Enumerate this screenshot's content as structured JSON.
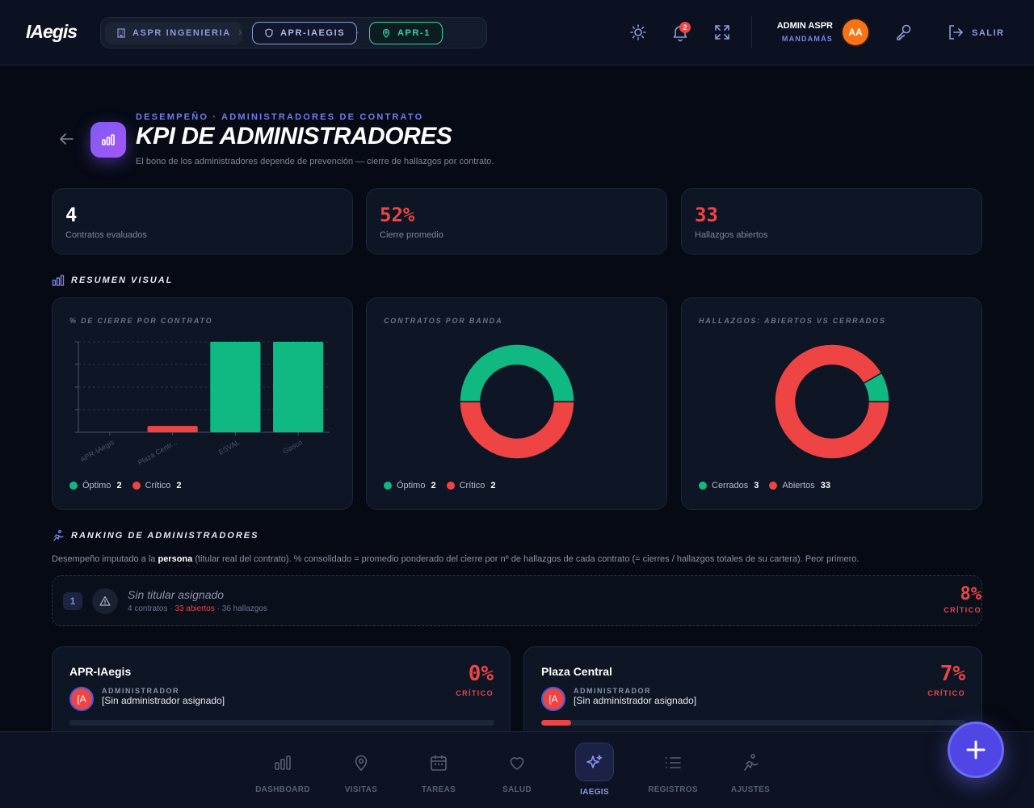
{
  "app": {
    "logo": "IAegis"
  },
  "breadcrumb": [
    {
      "label": "ASPR INGENIERIA"
    },
    {
      "label": "APR-IAEGIS"
    },
    {
      "label": "APR-1"
    }
  ],
  "header": {
    "notifications_count": "2",
    "user_name": "ADMIN ASPR",
    "user_role": "MANDAMÁS",
    "user_initials": "AA",
    "logout_label": "SALIR"
  },
  "page": {
    "eyebrow": "DESEMPEÑO · ADMINISTRADORES DE CONTRATO",
    "title": "KPI DE ADMINISTRADORES",
    "subtitle": "El bono de los administradores depende de prevención — cierre de hallazgos por contrato."
  },
  "kpis": [
    {
      "value": "4",
      "label": "Contratos evaluados",
      "color": "#ffffff"
    },
    {
      "value": "52%",
      "label": "Cierre promedio",
      "color": "#ef4444"
    },
    {
      "value": "33",
      "label": "Hallazgos abiertos",
      "color": "#ef4444"
    }
  ],
  "sections": {
    "visual": "RESUMEN VISUAL",
    "ranking": "RANKING DE ADMINISTRADORES"
  },
  "chart_data": [
    {
      "type": "bar",
      "title": "% DE CIERRE POR CONTRATO",
      "categories": [
        "APR-IAegis",
        "Plaza Centr...",
        "ESVAL",
        "Gasco"
      ],
      "values": [
        0,
        7,
        100,
        100
      ],
      "colors": [
        "#ef4444",
        "#ef4444",
        "#10b981",
        "#10b981"
      ],
      "ylim": [
        0,
        100
      ],
      "grid": true,
      "legend": [
        {
          "name": "Óptimo",
          "count": "2",
          "color": "#10b981"
        },
        {
          "name": "Crítico",
          "count": "2",
          "color": "#ef4444"
        }
      ]
    },
    {
      "type": "pie",
      "title": "CONTRATOS POR BANDA",
      "labels": [
        "Óptimo",
        "Crítico"
      ],
      "values": [
        2,
        2
      ],
      "colors": [
        "#10b981",
        "#ef4444"
      ],
      "legend": [
        {
          "name": "Óptimo",
          "count": "2",
          "color": "#10b981"
        },
        {
          "name": "Crítico",
          "count": "2",
          "color": "#ef4444"
        }
      ]
    },
    {
      "type": "pie",
      "title": "HALLAZGOS: ABIERTOS VS CERRADOS",
      "labels": [
        "Cerrados",
        "Abiertos"
      ],
      "values": [
        3,
        33
      ],
      "colors": [
        "#10b981",
        "#ef4444"
      ],
      "legend": [
        {
          "name": "Cerrados",
          "count": "3",
          "color": "#10b981"
        },
        {
          "name": "Abiertos",
          "count": "33",
          "color": "#ef4444"
        }
      ]
    }
  ],
  "ranking": {
    "desc_pre": "Desempeño imputado a la ",
    "desc_bold": "persona",
    "desc_post": " (titular real del contrato). % consolidado = promedio ponderado del cierre por nº de hallazgos de cada contrato (= cierres / hallazgos totales de su cartera). Peor primero.",
    "rows": [
      {
        "rank": "1",
        "name": "Sin titular asignado",
        "contracts": "4 contratos",
        "open": "33 abiertos",
        "findings": "36 hallazgos",
        "pct": "8%",
        "status": "CRÍTICO"
      }
    ]
  },
  "contracts": [
    {
      "name": "APR-IAegis",
      "initials": "[A",
      "role": "ADMINISTRADOR",
      "admin": "[Sin administrador asignado]",
      "pct": "0%",
      "status": "CRÍTICO",
      "progress": 0
    },
    {
      "name": "Plaza Central",
      "initials": "[A",
      "role": "ADMINISTRADOR",
      "admin": "[Sin administrador asignado]",
      "pct": "7%",
      "status": "CRÍTICO",
      "progress": 7
    }
  ],
  "nav": [
    {
      "label": "DASHBOARD",
      "icon": "bar-chart-icon"
    },
    {
      "label": "VISITAS",
      "icon": "map-pin-icon"
    },
    {
      "label": "TAREAS",
      "icon": "calendar-icon"
    },
    {
      "label": "SALUD",
      "icon": "heart-icon"
    },
    {
      "label": "IAEGIS",
      "icon": "sparkles-icon",
      "active": true
    },
    {
      "label": "REGISTROS",
      "icon": "list-icon"
    },
    {
      "label": "AJUSTES",
      "icon": "runner-icon"
    }
  ]
}
